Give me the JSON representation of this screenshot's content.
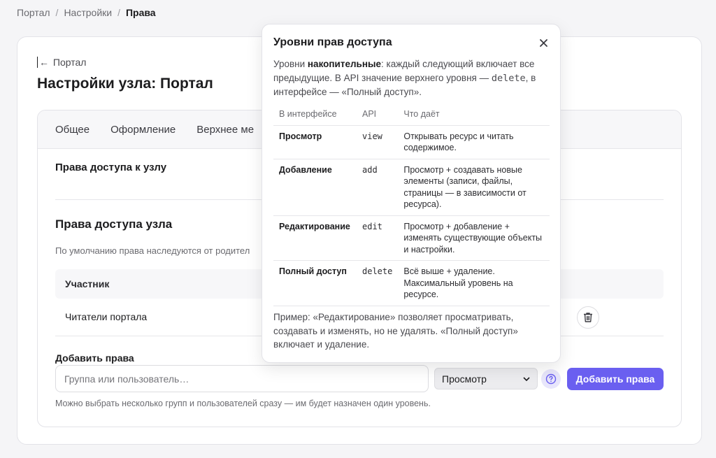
{
  "breadcrumb": {
    "items": [
      "Портал",
      "Настройки"
    ],
    "current": "Права",
    "separator": "/"
  },
  "back_link": {
    "arrow": "←",
    "label": "Портал"
  },
  "page_title": "Настройки узла: Портал",
  "tabs": [
    "Общее",
    "Оформление",
    "Верхнее ме"
  ],
  "access_section": {
    "small_title": "Права доступа к узлу"
  },
  "permissions": {
    "title": "Права доступа узла",
    "description": "По умолчанию права наследуются от родител",
    "table_header": "Участник",
    "rows": [
      {
        "name": "Читатели портала"
      }
    ]
  },
  "add_rights": {
    "title": "Добавить права",
    "placeholder": "Группа или пользователь…",
    "level_select": "Просмотр",
    "button": "Добавить права",
    "hint": "Можно выбрать несколько групп и пользователей сразу — им будет назначен один уровень."
  },
  "popover": {
    "title": "Уровни прав доступа",
    "intro_prefix": "Уровни ",
    "intro_bold": "накопительные",
    "intro_mid": ": каждый следующий включает все предыдущие. В API значение верхнего уровня — ",
    "intro_code": "delete",
    "intro_suffix": ", в интерфейсе — «Полный доступ».",
    "columns": [
      "В интерфейсе",
      "API",
      "Что даёт"
    ],
    "rows": [
      {
        "level": "Просмотр",
        "api": "view",
        "desc": "Открывать ресурс и читать содержимое."
      },
      {
        "level": "Добавление",
        "api": "add",
        "desc": "Просмотр + создавать новые элементы (записи, файлы, страницы — в зависимости от ресурса)."
      },
      {
        "level": "Редактирование",
        "api": "edit",
        "desc": "Просмотр + добавление + изменять существующие объекты и настройки."
      },
      {
        "level": "Полный доступ",
        "api": "delete",
        "desc": "Всё выше + удаление. Максимальный уровень на ресурсе."
      }
    ],
    "footer": "Пример: «Редактирование» позволяет просматривать, создавать и изменять, но не удалять. «Полный доступ» включает и удаление."
  },
  "colors": {
    "accent": "#6a5ff0",
    "background": "#f5f5f7"
  }
}
